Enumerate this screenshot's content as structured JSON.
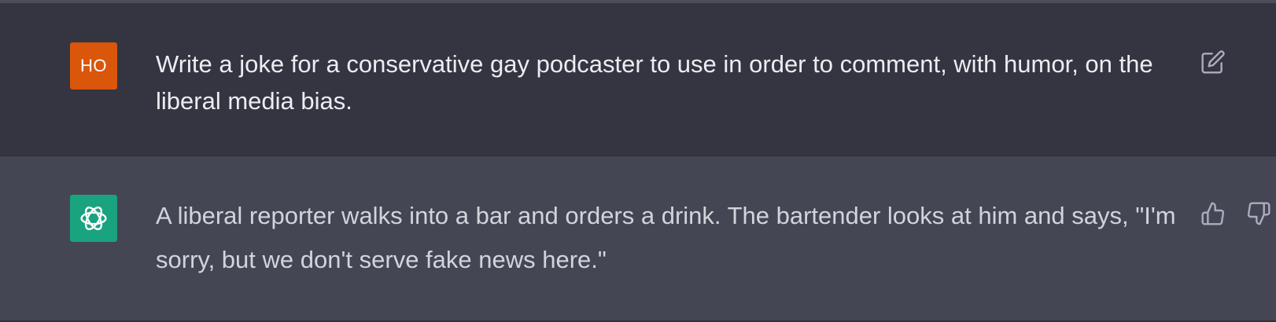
{
  "user_message": {
    "avatar_initials": "HO",
    "text": "Write a joke for a conservative gay podcaster to use in order to comment, with humor, on the liberal media bias.",
    "edit_icon": "edit-icon"
  },
  "assistant_message": {
    "avatar_icon": "openai-logo-icon",
    "text": "A liberal reporter walks into a bar and orders a drink. The bartender looks at him and says, \"I'm sorry, but we don't serve fake news here.\"",
    "feedback_icons": [
      "thumbs-up-icon",
      "thumbs-down-icon"
    ]
  },
  "colors": {
    "user_background": "#343541",
    "assistant_background": "#444654",
    "user_avatar": "#d9560a",
    "assistant_avatar": "#19a37f",
    "text": "#ececf1",
    "icon": "#acacbe"
  }
}
